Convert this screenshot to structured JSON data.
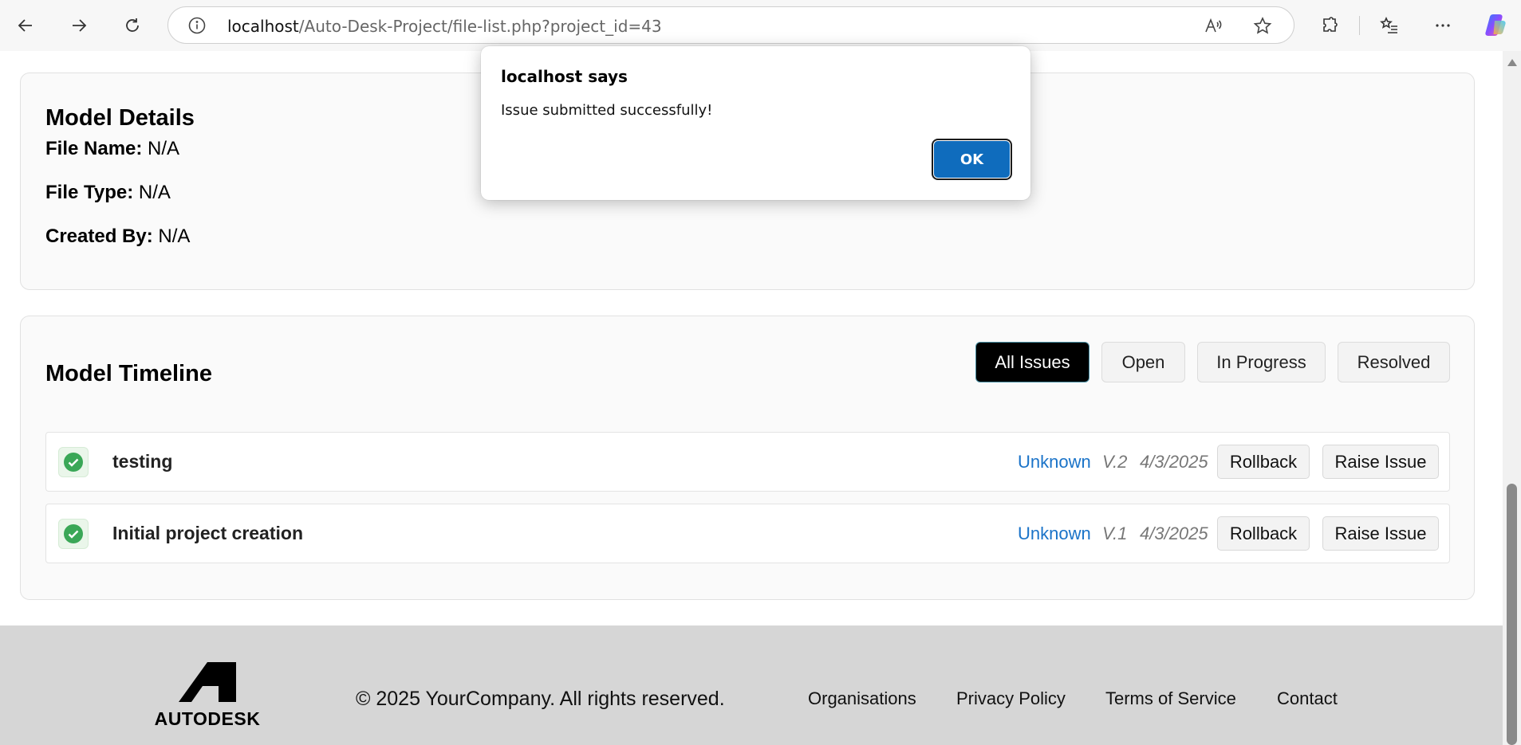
{
  "browser": {
    "url_host": "localhost",
    "url_path": "/Auto-Desk-Project/file-list.php?project_id=43"
  },
  "details": {
    "title": "Model Details",
    "file_name_label": "File Name:",
    "file_name_value": "N/A",
    "file_type_label": "File Type:",
    "file_type_value": "N/A",
    "created_by_label": "Created By:",
    "created_by_value": "N/A"
  },
  "timeline": {
    "title": "Model Timeline",
    "filters": [
      "All Issues",
      "Open",
      "In Progress",
      "Resolved"
    ],
    "active_filter": "All Issues",
    "rows": [
      {
        "title": "testing",
        "author": "Unknown",
        "version": "V.2",
        "date": "4/3/2025",
        "rollback": "Rollback",
        "raise": "Raise Issue"
      },
      {
        "title": "Initial project creation",
        "author": "Unknown",
        "version": "V.1",
        "date": "4/3/2025",
        "rollback": "Rollback",
        "raise": "Raise Issue"
      }
    ]
  },
  "footer": {
    "logo_text": "AUTODESK",
    "copyright": "© 2025 YourCompany. All rights reserved.",
    "links": [
      "Organisations",
      "Privacy Policy",
      "Terms of Service",
      "Contact"
    ]
  },
  "dialog": {
    "title": "localhost says",
    "message": "Issue submitted successfully!",
    "ok_label": "OK"
  },
  "colors": {
    "accent_blue": "#0f6cbd",
    "author_blue": "#1a73c8",
    "success_green": "#3aa757",
    "footer_bg": "#d6d6d6"
  },
  "icons": [
    "back-arrow-icon",
    "forward-arrow-icon",
    "refresh-icon",
    "info-icon",
    "read-aloud-icon",
    "favorite-star-icon",
    "extensions-icon",
    "favorites-list-icon",
    "more-icon",
    "copilot-icon",
    "check-circle-icon",
    "autodesk-logo-icon"
  ]
}
